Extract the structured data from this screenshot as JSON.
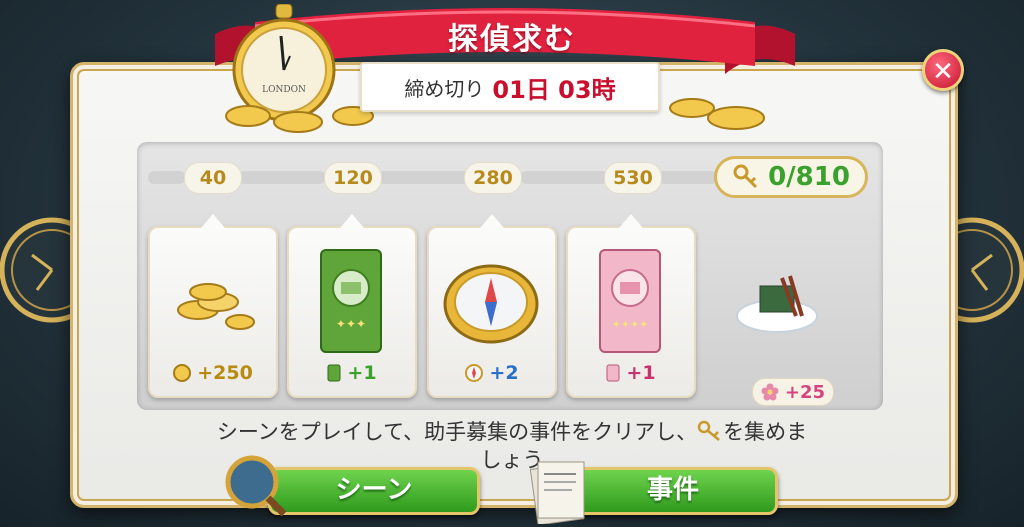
{
  "header": {
    "title": "探偵求む",
    "deadline_label": "締め切り",
    "deadline_value": "01日 03時",
    "watch_text": "LONDON"
  },
  "progress": {
    "milestones": [
      "40",
      "120",
      "280",
      "530"
    ],
    "key_count": "0/810"
  },
  "rewards": [
    {
      "icon": "coin-icon",
      "amount": "+250",
      "color": "#b88a10"
    },
    {
      "icon": "green-book-icon",
      "amount": "+1",
      "color": "#3aa12d"
    },
    {
      "icon": "compass-icon",
      "amount": "+2",
      "color": "#2a6fc8"
    },
    {
      "icon": "pink-book-icon",
      "amount": "+1",
      "color": "#c8306e"
    }
  ],
  "bonus": {
    "amount": "+25"
  },
  "instructions": "シーンをプレイして、助手募集の事件をクリアし、 を集めましょう",
  "instruction_parts": [
    "シーンをプレイして、助手募集の事件をクリアし、",
    "を集めま",
    "しょう"
  ],
  "buttons": {
    "scene": "シーン",
    "case": "事件"
  },
  "colors": {
    "accent_red": "#c8102e",
    "green": "#3aa12d",
    "gold": "#d4b46a"
  }
}
